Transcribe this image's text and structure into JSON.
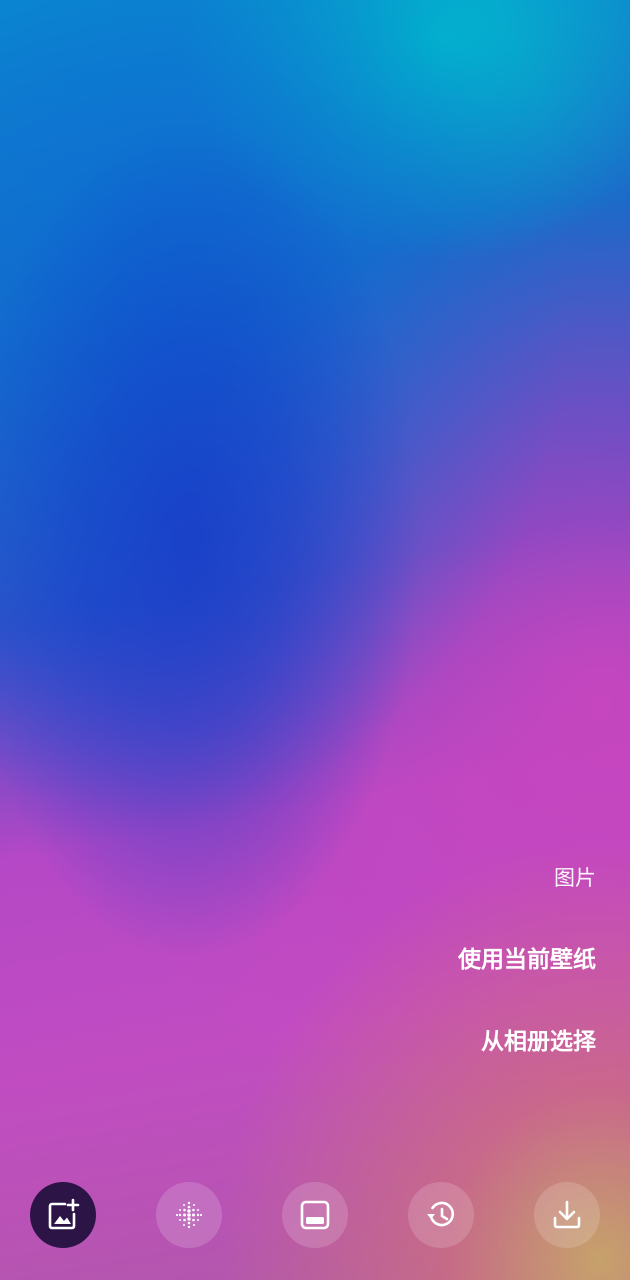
{
  "menu": {
    "title": "图片",
    "items": [
      {
        "label": "使用当前壁纸"
      },
      {
        "label": "从相册选择"
      }
    ]
  },
  "toolbar": {
    "buttons": [
      {
        "icon": "add-image-icon",
        "active": true
      },
      {
        "icon": "dot-grid-icon",
        "active": false
      },
      {
        "icon": "lock-screen-panel-icon",
        "active": false
      },
      {
        "icon": "history-icon",
        "active": false
      },
      {
        "icon": "download-icon",
        "active": false
      }
    ],
    "active_color": "#2c1446"
  }
}
